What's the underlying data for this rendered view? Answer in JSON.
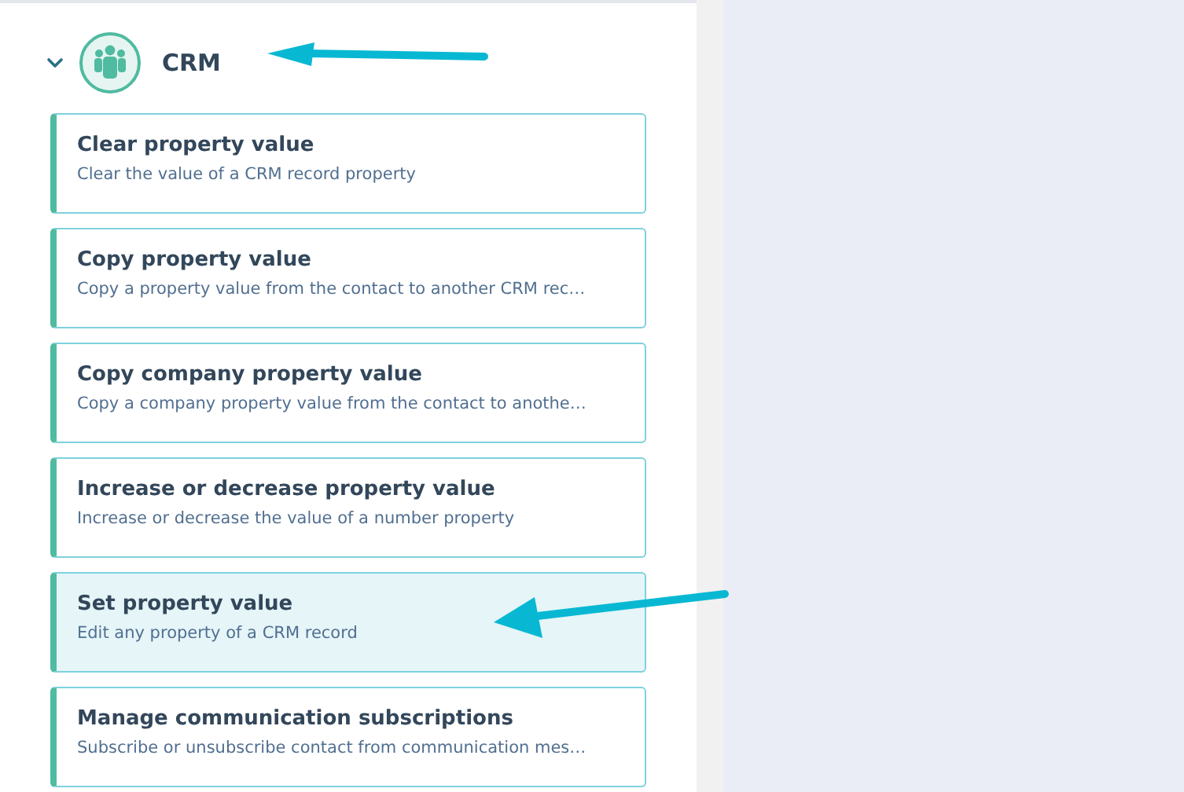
{
  "group": {
    "title": "CRM",
    "expanded": true
  },
  "actions": [
    {
      "title": "Clear property value",
      "description": "Clear the value of a CRM record property",
      "selected": false
    },
    {
      "title": "Copy property value",
      "description": "Copy a property value from the contact to another CRM rec…",
      "selected": false
    },
    {
      "title": "Copy company property value",
      "description": "Copy a company property value from the contact to anothe…",
      "selected": false
    },
    {
      "title": "Increase or decrease property value",
      "description": "Increase or decrease the value of a number property",
      "selected": false
    },
    {
      "title": "Set property value",
      "description": "Edit any property of a CRM record",
      "selected": true
    },
    {
      "title": "Manage communication subscriptions",
      "description": "Subscribe or unsubscribe contact from communication mes…",
      "selected": false
    }
  ]
}
